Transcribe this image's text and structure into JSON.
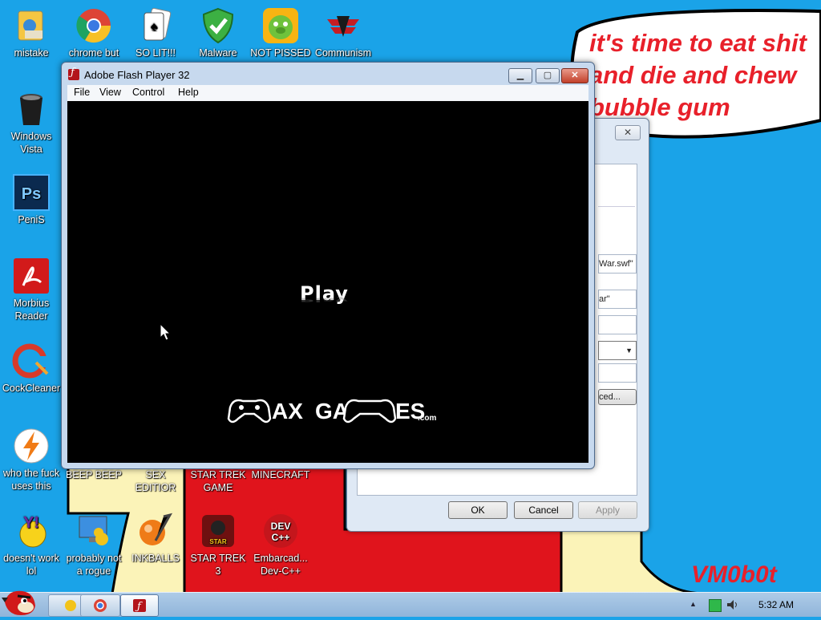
{
  "bubble": {
    "text": "it's time to eat shit\nand die and chew\nbubble gum"
  },
  "signature": "VM0b0t",
  "desktop_icons": [
    {
      "label": "mistake",
      "icon": "control-panel-icon"
    },
    {
      "label": "chrome but",
      "icon": "chrome-icon"
    },
    {
      "label": "SO LIT!!!",
      "icon": "cards-icon"
    },
    {
      "label": "Malware",
      "icon": "shield-icon"
    },
    {
      "label": "NOT PISSED",
      "icon": "angry-pig-icon"
    },
    {
      "label": "Communism",
      "icon": "emblem-icon"
    },
    {
      "label": "Windows Vista",
      "icon": "trash-icon"
    },
    {
      "label": "PeniS",
      "icon": "photoshop-icon"
    },
    {
      "label": "Morbius Reader",
      "icon": "pdf-icon"
    },
    {
      "label": "CockCleaner",
      "icon": "ccleaner-icon"
    },
    {
      "label": "who the fuck uses this",
      "icon": "lightning-icon"
    },
    {
      "label": "BEEP BEEP",
      "icon": "app-icon"
    },
    {
      "label": "SEX EDITIOR",
      "icon": "app-icon"
    },
    {
      "label": "STAR TREK GAME",
      "icon": "app-icon"
    },
    {
      "label": "MINECRAFT",
      "icon": "app-icon"
    },
    {
      "label": "doesn't work lol",
      "icon": "yahoo-icon"
    },
    {
      "label": "probably not a rogue",
      "icon": "monitor-icon"
    },
    {
      "label": "INKBALLS",
      "icon": "inkball-icon"
    },
    {
      "label": "STAR TREK 3",
      "icon": "star-wars-icon"
    },
    {
      "label": "Embarcad... Dev-C++",
      "icon": "devcpp-icon"
    }
  ],
  "flash_window": {
    "title": "Adobe Flash Player 32",
    "menu": [
      "File",
      "View",
      "Control",
      "Help"
    ],
    "play_label": "Play",
    "logo_text": "MAX GAMES"
  },
  "dialog": {
    "fields": [
      "War.swf\"",
      "ar\""
    ],
    "advanced_label": "ced...",
    "ok": "OK",
    "cancel": "Cancel",
    "apply": "Apply"
  },
  "taskbar": {
    "clock": "5:32 AM"
  },
  "colors": {
    "wall_blue": "#1aa3e8",
    "wall_red": "#e0141c",
    "wall_yellow": "#fbf3b8",
    "bubble_text": "#e8202a"
  }
}
